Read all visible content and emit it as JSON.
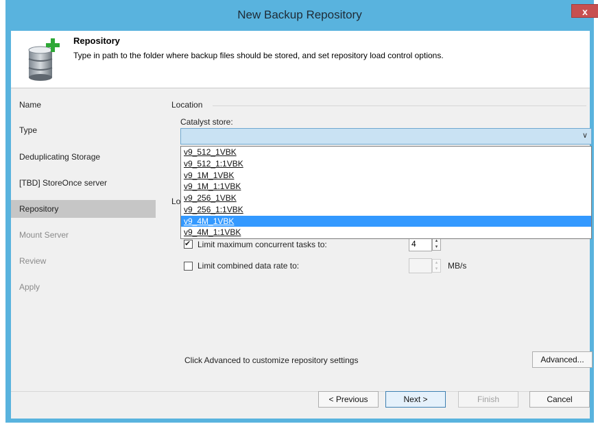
{
  "window": {
    "title": "New Backup Repository",
    "close_glyph": "x"
  },
  "header": {
    "title": "Repository",
    "description": "Type in path to the folder where backup files should be stored, and set repository load control options."
  },
  "steps": [
    {
      "label": "Name",
      "state": "normal"
    },
    {
      "label": "Type",
      "state": "normal"
    },
    {
      "label": "Deduplicating Storage",
      "state": "normal"
    },
    {
      "label": "[TBD] StoreOnce server",
      "state": "normal"
    },
    {
      "label": "Repository",
      "state": "active"
    },
    {
      "label": "Mount Server",
      "state": "disabled"
    },
    {
      "label": "Review",
      "state": "disabled"
    },
    {
      "label": "Apply",
      "state": "disabled"
    }
  ],
  "location": {
    "group_label": "Location",
    "catalyst_label": "Catalyst store:",
    "catalyst_value": "",
    "dropdown_arrow": "∨",
    "options": [
      "v9_512_1VBK",
      "v9_512_1:1VBK",
      "v9_1M_1VBK",
      "v9_1M_1:1VBK",
      "v9_256_1VBK",
      "v9_256_1:1VBK",
      "v9_4M_1VBK",
      "v9_4M_1:1VBK"
    ],
    "selected_index": 6
  },
  "load_control": {
    "group_label_partial": "Lo",
    "limit_tasks_label": "Limit maximum concurrent tasks to:",
    "limit_tasks_checked": true,
    "limit_tasks_value": "4",
    "limit_rate_label": "Limit combined data rate to:",
    "limit_rate_checked": false,
    "limit_rate_value": "",
    "limit_rate_unit": "MB/s"
  },
  "advanced": {
    "hint": "Click Advanced to customize repository settings",
    "button": "Advanced..."
  },
  "footer": {
    "previous": "< Previous",
    "next": "Next >",
    "finish": "Finish",
    "cancel": "Cancel"
  },
  "colors": {
    "titlebar": "#59b3de",
    "selected_item": "#3399ff",
    "combo_fill": "#c9e2f3",
    "active_step": "#c6c6c6"
  },
  "icons": {
    "header": "database-add-icon",
    "spin_up": "▴",
    "spin_down": "▾"
  }
}
